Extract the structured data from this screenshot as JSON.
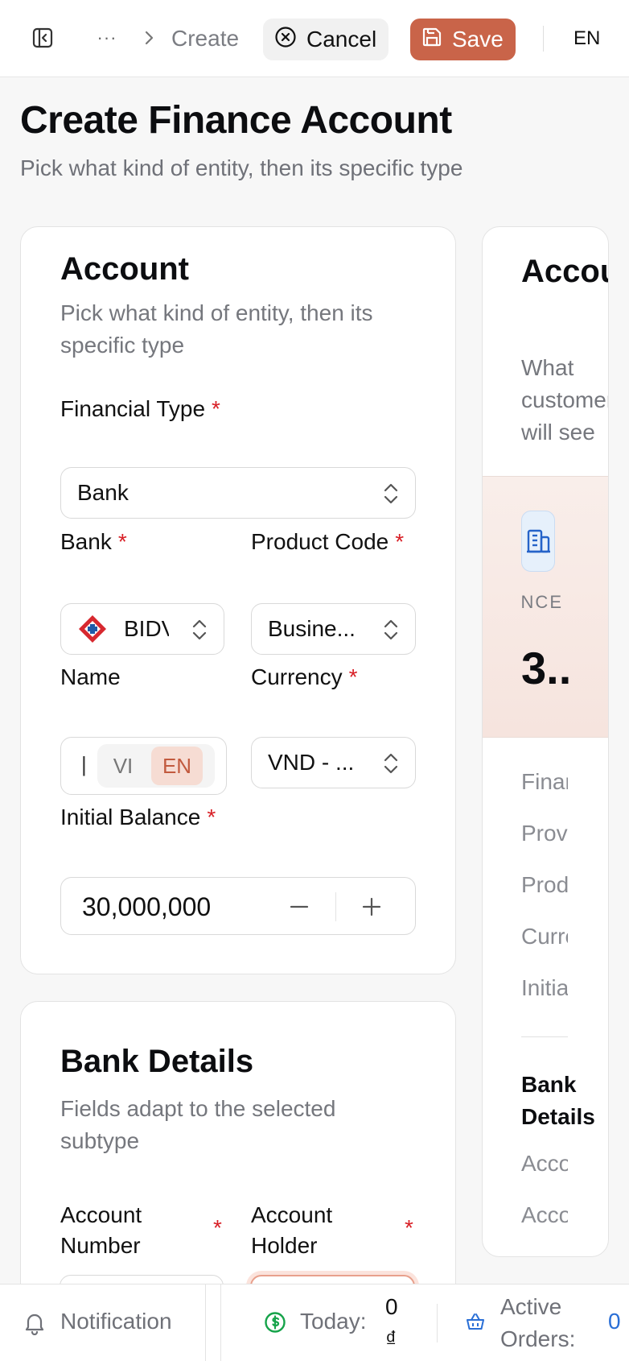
{
  "topbar": {
    "ellipsis": "···",
    "breadcrumb": "Create",
    "cancel_label": "Cancel",
    "save_label": "Save",
    "language": "EN"
  },
  "page": {
    "title": "Create Finance Account",
    "subtitle": "Pick what kind of entity, then its specific type"
  },
  "account_card": {
    "title": "Account",
    "description": "Pick what kind of entity, then its specific type",
    "financial_type": {
      "label": "Financial Type",
      "required": "*",
      "value": "Bank"
    },
    "bank": {
      "label": "Bank",
      "required": "*",
      "value": "BIDV"
    },
    "product_code": {
      "label": "Product Code",
      "required": "*",
      "value": "Busine..."
    },
    "name": {
      "label": "Name",
      "lang_options": [
        "VI",
        "EN"
      ],
      "active_lang": "EN"
    },
    "currency": {
      "label": "Currency",
      "required": "*",
      "value": "VND - ..."
    },
    "initial_balance": {
      "label": "Initial Balance",
      "required": "*",
      "value": "30,000,000"
    }
  },
  "bank_details_card": {
    "title": "Bank Details",
    "description": "Fields adapt to the selected subtype",
    "account_number": {
      "label": "Account Number",
      "required": "*"
    },
    "account_holder": {
      "label": "Account Holder",
      "required": "*"
    }
  },
  "preview_card": {
    "title": "Account Preview",
    "subtitle": "What customers will see",
    "balance_label": "TOTAL BALANCE",
    "balance_value": "3..",
    "rows": [
      "Financial Type",
      "Provider",
      "Product Code",
      "Currency",
      "Initial Balance"
    ],
    "section": "Bank Details",
    "section_rows": [
      "Account Number",
      "Account Holder"
    ]
  },
  "statusbar": {
    "notification": "Notification",
    "today_label": "Today:",
    "today_value": "0 ₫",
    "orders_label": "Active Orders:",
    "orders_value": "0"
  },
  "colors": {
    "accent": "#c96449",
    "required": "#d81f26",
    "link_blue": "#2a6fd6",
    "money_green": "#16a34a"
  }
}
